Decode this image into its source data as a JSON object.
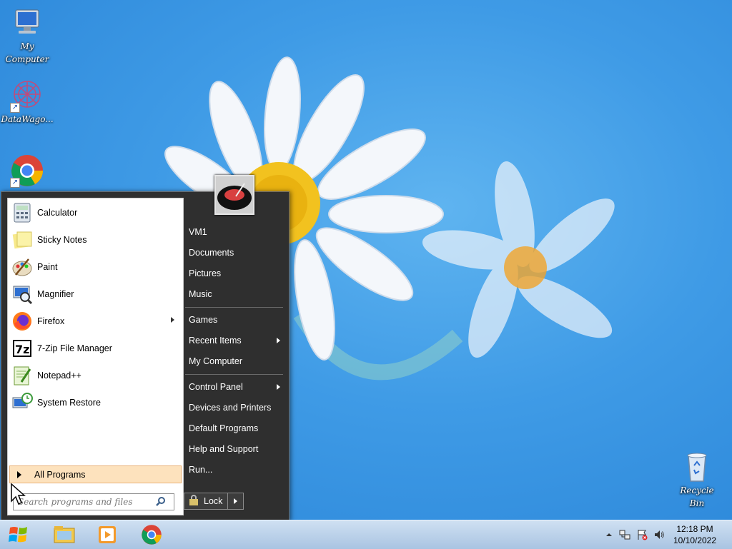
{
  "desktop": {
    "icons": [
      {
        "label": "My Computer",
        "icon": "computer-icon"
      },
      {
        "label": "DataWago...",
        "icon": "datawagon-icon"
      },
      {
        "label": "",
        "icon": "chrome-icon"
      },
      {
        "label": "Recycle Bin",
        "icon": "recycle-bin-icon"
      }
    ]
  },
  "start_menu": {
    "programs": [
      {
        "label": "Calculator",
        "icon": "calculator-icon"
      },
      {
        "label": "Sticky Notes",
        "icon": "sticky-notes-icon"
      },
      {
        "label": "Paint",
        "icon": "paint-icon"
      },
      {
        "label": "Magnifier",
        "icon": "magnifier-icon"
      },
      {
        "label": "Firefox",
        "icon": "firefox-icon",
        "has_submenu": true
      },
      {
        "label": "7-Zip File Manager",
        "icon": "7zip-icon"
      },
      {
        "label": "Notepad++",
        "icon": "notepadpp-icon"
      },
      {
        "label": "System Restore",
        "icon": "system-restore-icon"
      }
    ],
    "all_programs_label": "All Programs",
    "search_placeholder": "Search programs and files",
    "right_items": [
      {
        "label": "VM1"
      },
      {
        "label": "Documents"
      },
      {
        "label": "Pictures"
      },
      {
        "label": "Music"
      },
      {
        "label": "Games"
      },
      {
        "label": "Recent Items",
        "has_submenu": true
      },
      {
        "label": "My Computer"
      },
      {
        "label": "Control Panel",
        "has_submenu": true
      },
      {
        "label": "Devices and Printers"
      },
      {
        "label": "Default Programs"
      },
      {
        "label": "Help and Support"
      },
      {
        "label": "Run..."
      }
    ],
    "lock_label": "Lock"
  },
  "taskbar": {
    "pinned": [
      {
        "icon": "start-orb-icon"
      },
      {
        "icon": "file-explorer-icon"
      },
      {
        "icon": "media-player-icon"
      },
      {
        "icon": "chrome-icon"
      }
    ],
    "tray_icons": [
      "show-hidden-icons-icon",
      "network-icon",
      "action-center-icon",
      "volume-icon"
    ],
    "clock_time": "12:18 PM",
    "clock_date": "10/10/2022"
  },
  "colors": {
    "desktop_blue": "#3f9be6",
    "start_menu_dark": "#2f2f2f",
    "all_programs_highlight": "#fde2bd"
  }
}
